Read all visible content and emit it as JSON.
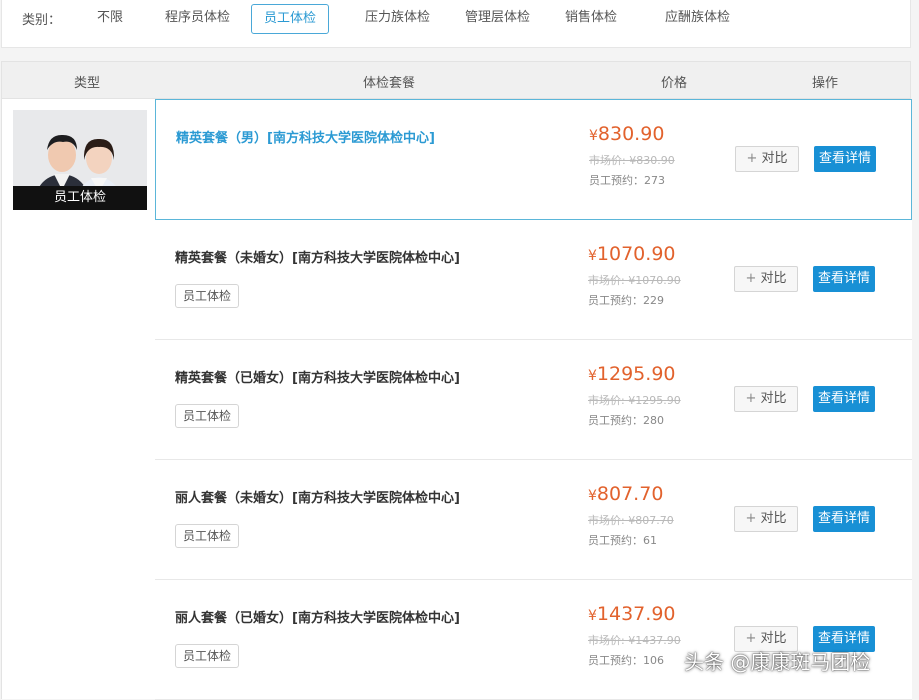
{
  "filter": {
    "label": "类别：",
    "categories": [
      "不限",
      "程序员体检",
      "员工体检",
      "压力族体检",
      "管理层体检",
      "销售体检",
      "应酬族体检"
    ],
    "active": "员工体检"
  },
  "table": {
    "headers": {
      "type": "类型",
      "package": "体检套餐",
      "price": "价格",
      "action": "操作"
    },
    "type_card": {
      "caption": "员工体检"
    }
  },
  "colors": {
    "accent": "#2b9ad3",
    "price": "#e2622d",
    "button": "#1890d5"
  },
  "packages": [
    {
      "name": "精英套餐（男）[南方科技大学医院体检中心]",
      "tag": "",
      "price": "830.90",
      "market": "市场价: ¥830.90",
      "booked": "员工预约：273",
      "compare": "对比",
      "detail": "查看详情"
    },
    {
      "name": "精英套餐（未婚女）[南方科技大学医院体检中心]",
      "tag": "员工体检",
      "price": "1070.90",
      "market": "市场价: ¥1070.90",
      "booked": "员工预约：229",
      "compare": "对比",
      "detail": "查看详情"
    },
    {
      "name": "精英套餐（已婚女）[南方科技大学医院体检中心]",
      "tag": "员工体检",
      "price": "1295.90",
      "market": "市场价: ¥1295.90",
      "booked": "员工预约：280",
      "compare": "对比",
      "detail": "查看详情"
    },
    {
      "name": "丽人套餐（未婚女）[南方科技大学医院体检中心]",
      "tag": "员工体检",
      "price": "807.70",
      "market": "市场价: ¥807.70",
      "booked": "员工预约：61",
      "compare": "对比",
      "detail": "查看详情"
    },
    {
      "name": "丽人套餐（已婚女）[南方科技大学医院体检中心]",
      "tag": "员工体检",
      "price": "1437.90",
      "market": "市场价: ¥1437.90",
      "booked": "员工预约：106",
      "compare": "对比",
      "detail": "查看详情"
    }
  ],
  "currency": "¥",
  "watermark": "头条 @康康斑马团检"
}
